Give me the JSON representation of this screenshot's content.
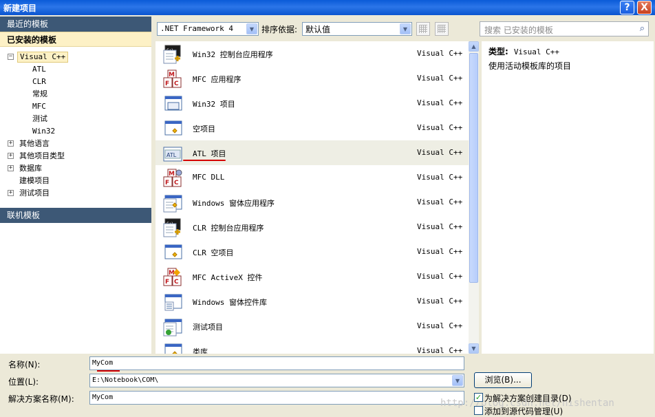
{
  "window": {
    "title": "新建项目",
    "help_label": "?",
    "close_label": "X"
  },
  "left": {
    "recent": "最近的模板",
    "installed": "已安装的模板",
    "online": "联机模板",
    "tree": [
      {
        "label": "Visual C++",
        "expander": "−",
        "selected": true
      },
      {
        "label": "ATL",
        "child": true
      },
      {
        "label": "CLR",
        "child": true
      },
      {
        "label": "常规",
        "child": true
      },
      {
        "label": "MFC",
        "child": true
      },
      {
        "label": "测试",
        "child": true
      },
      {
        "label": "Win32",
        "child": true
      },
      {
        "label": "其他语言",
        "expander": "+"
      },
      {
        "label": "其他项目类型",
        "expander": "+"
      },
      {
        "label": "数据库",
        "expander": "+"
      },
      {
        "label": "建模项目"
      },
      {
        "label": "测试项目",
        "expander": "+"
      }
    ]
  },
  "toolbar": {
    "framework": ".NET Framework 4",
    "sort_label": "排序依据:",
    "sort_value": "默认值",
    "search_placeholder": "搜索 已安装的模板"
  },
  "templates": [
    {
      "name": "Win32 控制台应用程序",
      "lang": "Visual C++",
      "icon": "console-icon"
    },
    {
      "name": "MFC 应用程序",
      "lang": "Visual C++",
      "icon": "mfc-icon"
    },
    {
      "name": "Win32 项目",
      "lang": "Visual C++",
      "icon": "window-icon"
    },
    {
      "name": "空项目",
      "lang": "Visual C++",
      "icon": "empty-project-icon"
    },
    {
      "name": "ATL 项目",
      "lang": "Visual C++",
      "icon": "atl-icon",
      "selected": true
    },
    {
      "name": "MFC DLL",
      "lang": "Visual C++",
      "icon": "mfc-dll-icon"
    },
    {
      "name": "Windows 窗体应用程序",
      "lang": "Visual C++",
      "icon": "form-app-icon"
    },
    {
      "name": "CLR 控制台应用程序",
      "lang": "Visual C++",
      "icon": "console-icon"
    },
    {
      "name": "CLR 空项目",
      "lang": "Visual C++",
      "icon": "empty-project-icon"
    },
    {
      "name": "MFC ActiveX 控件",
      "lang": "Visual C++",
      "icon": "mfc-activex-icon"
    },
    {
      "name": "Windows 窗体控件库",
      "lang": "Visual C++",
      "icon": "form-control-icon"
    },
    {
      "name": "测试项目",
      "lang": "Visual C++",
      "icon": "test-project-icon"
    },
    {
      "name": "类库",
      "lang": "Visual C++",
      "icon": "class-library-icon"
    }
  ],
  "details": {
    "type_label": "类型:",
    "type_value": "Visual C++",
    "description": "使用活动模板库的项目"
  },
  "form": {
    "name_label": "名称(N):",
    "name_value": "MyCom",
    "location_label": "位置(L):",
    "location_value": "E:\\Notebook\\COM\\",
    "solution_label": "解决方案名称(M):",
    "solution_value": "MyCom",
    "browse_label": "浏览(B)...",
    "create_dir_label": "为解决方案创建目录(D)",
    "create_dir_checked": true,
    "source_control_label": "添加到源代码管理(U)",
    "source_control_checked": false
  },
  "watermark": "http://blog.csdn.net/hishentan",
  "colors": {
    "title_bar": "#0a5bd8",
    "section_dark": "#3d5876",
    "section_selected": "#fdf1c6",
    "selected_row": "#eeeee4"
  }
}
